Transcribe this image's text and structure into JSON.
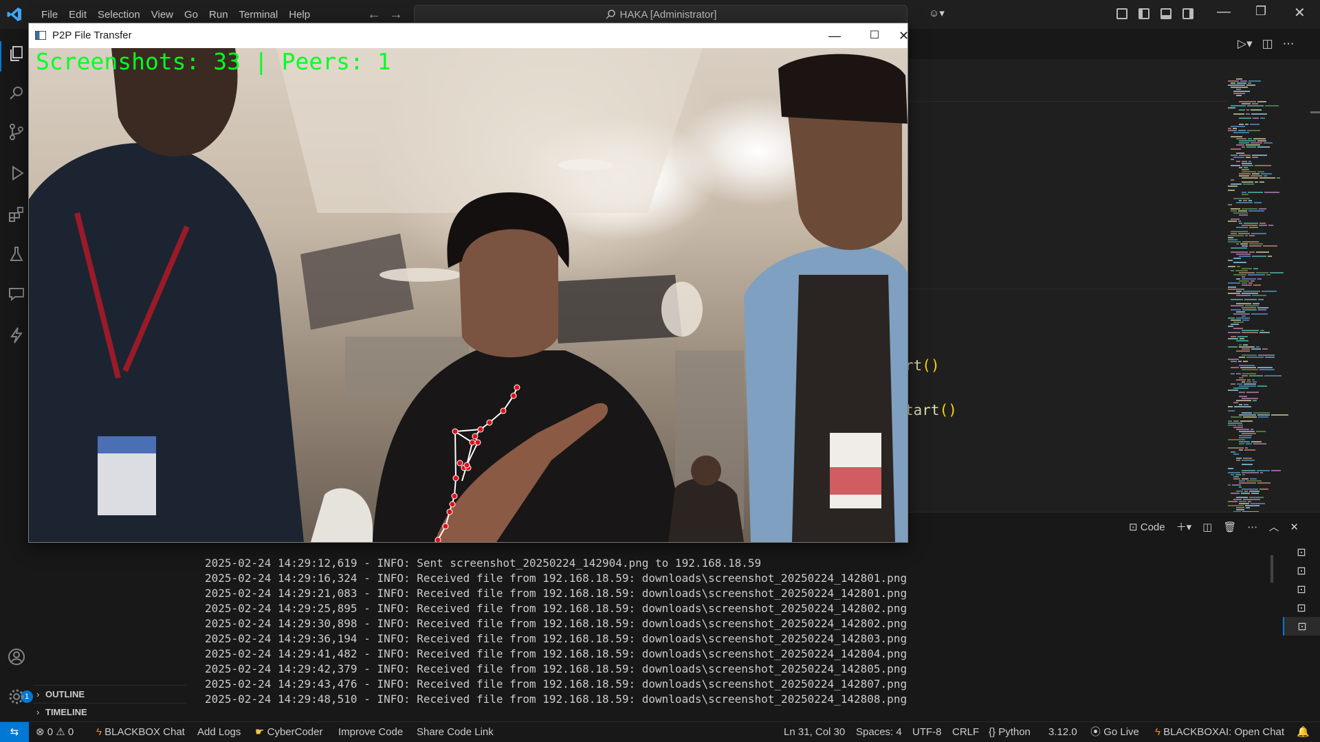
{
  "menu": [
    "File",
    "Edit",
    "Selection",
    "View",
    "Go",
    "Run",
    "Terminal",
    "Help"
  ],
  "command_center": "HAKA [Administrator]",
  "p2p_window": {
    "title": "P2P File Transfer",
    "overlay": "Screenshots: 33 | Peers: 1",
    "overlay_color": "#00ff22",
    "hand_landmark_color": "#e0101a"
  },
  "editor": {
    "code_fragment_1": "rt()",
    "code_fragment_2": "tart()"
  },
  "panel": {
    "terminal_profile": "Code",
    "terminal_lines": [
      "2025-02-24 14:29:12,619 - INFO: Sent screenshot_20250224_142904.png to 192.168.18.59",
      "2025-02-24 14:29:16,324 - INFO: Received file from 192.168.18.59: downloads\\screenshot_20250224_142801.png",
      "2025-02-24 14:29:21,083 - INFO: Received file from 192.168.18.59: downloads\\screenshot_20250224_142801.png",
      "2025-02-24 14:29:25,895 - INFO: Received file from 192.168.18.59: downloads\\screenshot_20250224_142802.png",
      "2025-02-24 14:29:30,898 - INFO: Received file from 192.168.18.59: downloads\\screenshot_20250224_142802.png",
      "2025-02-24 14:29:36,194 - INFO: Received file from 192.168.18.59: downloads\\screenshot_20250224_142803.png",
      "2025-02-24 14:29:41,482 - INFO: Received file from 192.168.18.59: downloads\\screenshot_20250224_142804.png",
      "2025-02-24 14:29:42,379 - INFO: Received file from 192.168.18.59: downloads\\screenshot_20250224_142805.png",
      "2025-02-24 14:29:43,476 - INFO: Received file from 192.168.18.59: downloads\\screenshot_20250224_142807.png",
      "2025-02-24 14:29:48,510 - INFO: Received file from 192.168.18.59: downloads\\screenshot_20250224_142808.png"
    ]
  },
  "sidebar": {
    "outline": "OUTLINE",
    "timeline": "TIMELINE"
  },
  "accounts_badge": "1",
  "statusbar": {
    "errors": "0",
    "warnings": "0",
    "blackbox_chat": "BLACKBOX Chat",
    "add_logs": "Add Logs",
    "cybercoder": "CyberCoder",
    "improve_code": "Improve Code",
    "share_code_link": "Share Code Link",
    "cursor": "Ln 31, Col 30",
    "spaces": "Spaces: 4",
    "encoding": "UTF-8",
    "eol": "CRLF",
    "language": "Python",
    "version": "3.12.0",
    "go_live": "Go Live",
    "blackboxai": "BLACKBOXAI: Open Chat"
  },
  "colors": {
    "accent": "#0078d4",
    "background": "#1f1f1f",
    "function_yellow": "#dcdcaa"
  }
}
